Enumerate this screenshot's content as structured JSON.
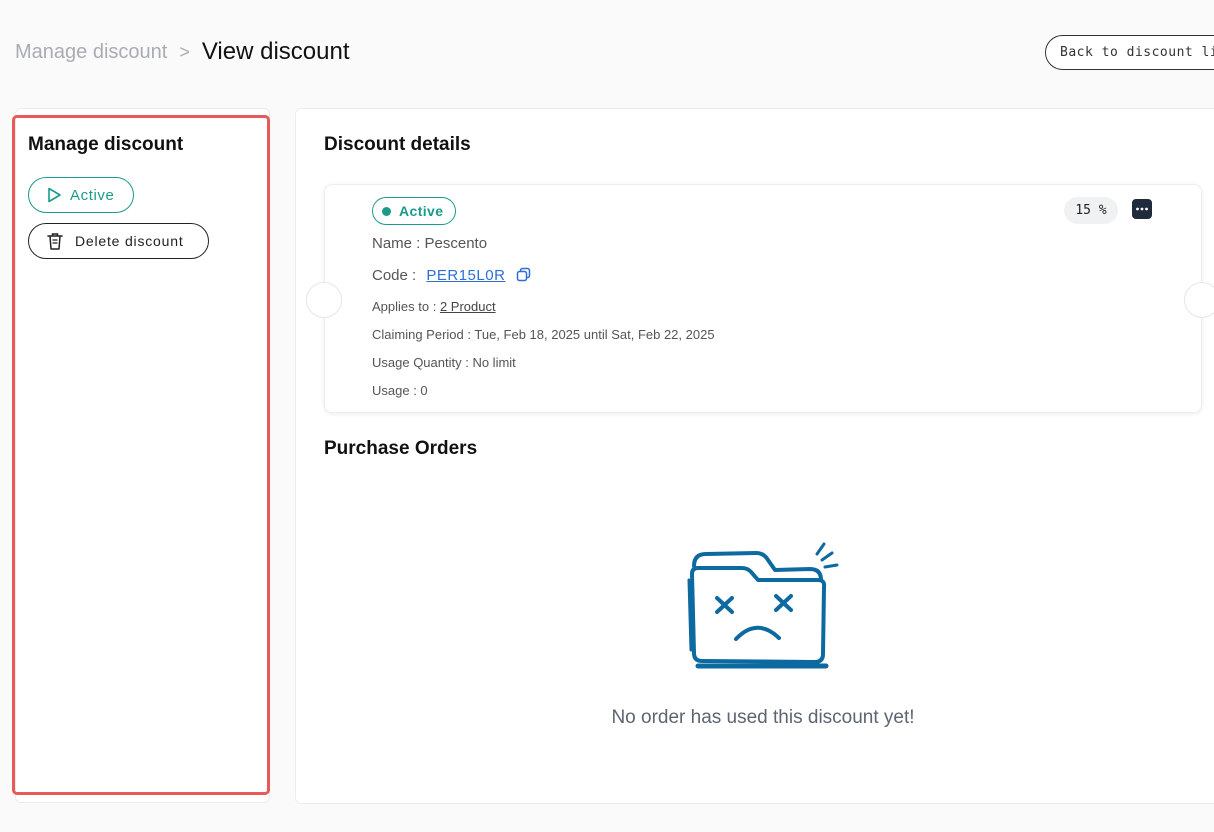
{
  "breadcrumb": {
    "parent": "Manage discount",
    "separator": ">",
    "current": "View discount"
  },
  "header": {
    "back_button_label": "Back to discount list"
  },
  "sidebar": {
    "title": "Manage discount",
    "active_button_label": "Active",
    "delete_button_label": "Delete discount"
  },
  "details": {
    "section_title": "Discount details",
    "status": "Active",
    "percent": "15 %",
    "name_label": "Name : ",
    "name_value": "Pescento",
    "code_label": "Code : ",
    "code_value": "PER15L0R",
    "applies_label": "Applies to : ",
    "applies_value": "2 Product",
    "claiming_label": "Claiming Period : ",
    "claiming_value": "Tue, Feb 18, 2025 until Sat, Feb 22, 2025",
    "usage_qty_label": "Usage Quantity : ",
    "usage_qty_value": "No limit",
    "usage_label": "Usage : ",
    "usage_value": "0"
  },
  "orders": {
    "section_title": "Purchase Orders",
    "empty_message": "No order has used this discount yet!"
  },
  "colors": {
    "accent_green": "#1a9b8a",
    "link_blue": "#2d6fd3",
    "illustration_blue": "#0d6aa0",
    "highlight_red": "#e8595a"
  }
}
